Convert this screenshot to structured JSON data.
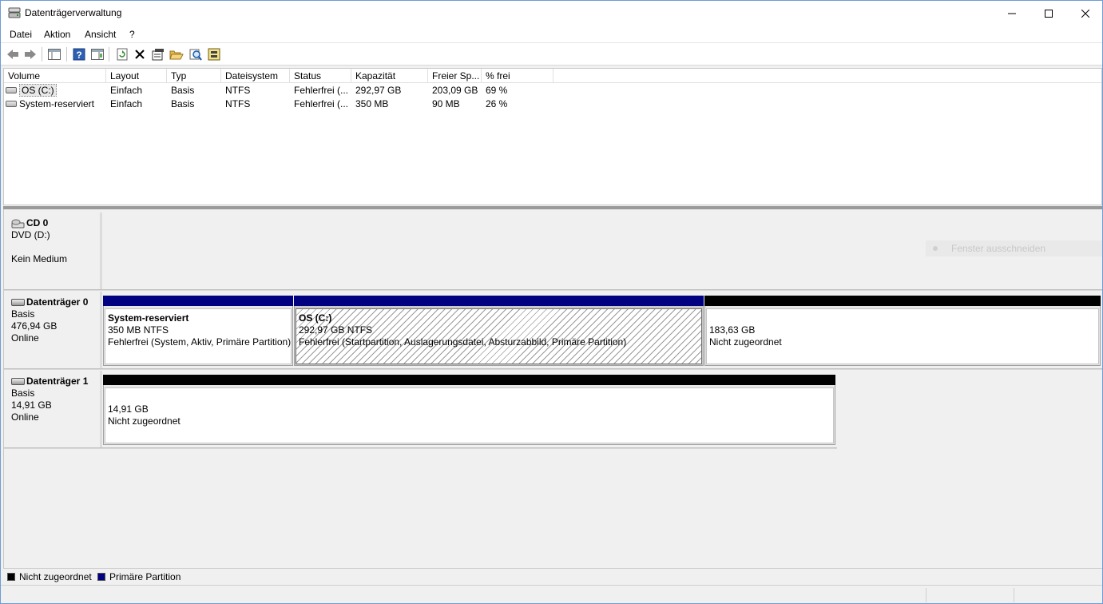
{
  "window": {
    "title": "Datenträgerverwaltung"
  },
  "menu": [
    "Datei",
    "Aktion",
    "Ansicht",
    "?"
  ],
  "toolbar_icons": [
    "back-arrow-icon",
    "forward-arrow-icon",
    "console-tree-icon",
    "help-icon",
    "action-pane-icon",
    "refresh-icon",
    "delete-icon",
    "properties-icon",
    "open-folder-icon",
    "search-icon",
    "rescan-icon"
  ],
  "volume_list": {
    "columns": [
      "Volume",
      "Layout",
      "Typ",
      "Dateisystem",
      "Status",
      "Kapazität",
      "Freier Sp...",
      "% frei"
    ],
    "rows": [
      [
        "OS (C:)",
        "Einfach",
        "Basis",
        "NTFS",
        "Fehlerfrei (...",
        "292,97 GB",
        "203,09 GB",
        "69 %"
      ],
      [
        "System-reserviert",
        "Einfach",
        "Basis",
        "NTFS",
        "Fehlerfrei (...",
        "350 MB",
        "90 MB",
        "26 %"
      ]
    ]
  },
  "disks": [
    {
      "name": "CD 0",
      "line1": "DVD (D:)",
      "line2": "",
      "line3": "Kein Medium"
    },
    {
      "name": "Datenträger 0",
      "line1": "Basis",
      "line2": "476,94 GB",
      "line3": "Online",
      "partitions": [
        {
          "title": "System-reserviert",
          "size": "350 MB NTFS",
          "status": "Fehlerfrei (System, Aktiv, Primäre Partition)"
        },
        {
          "title": "OS  (C:)",
          "size": "292,97 GB NTFS",
          "status": "Fehlerfrei (Startpartition, Auslagerungsdatei, Absturzabbild, Primäre Partition)"
        },
        {
          "title": "",
          "size": "183,63 GB",
          "status": "Nicht zugeordnet"
        }
      ]
    },
    {
      "name": "Datenträger 1",
      "line1": "Basis",
      "line2": "14,91 GB",
      "line3": "Online",
      "partitions": [
        {
          "title": "",
          "size": "14,91 GB",
          "status": "Nicht zugeordnet"
        }
      ]
    }
  ],
  "ghost_tooltip": "Fenster ausschneiden",
  "legend": [
    {
      "label": "Nicht zugeordnet",
      "color": "#000000"
    },
    {
      "label": "Primäre Partition",
      "color": "#000080"
    }
  ],
  "colors": {
    "primary": "#000080",
    "unallocated": "#000000"
  }
}
